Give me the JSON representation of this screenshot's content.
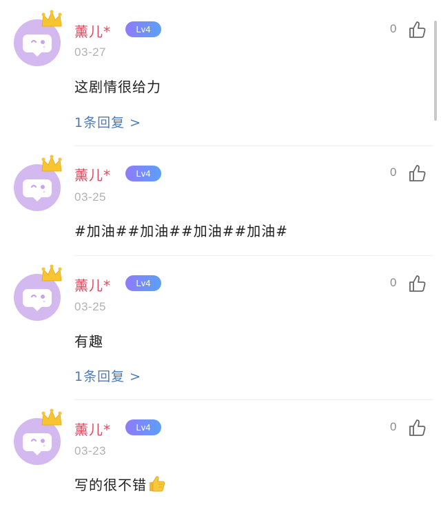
{
  "comments": [
    {
      "username": "薰儿*",
      "level": "Lv4",
      "date": "03-27",
      "text": "这剧情很给力",
      "replies": "1条回复 >",
      "likes": "0"
    },
    {
      "username": "薰儿*",
      "level": "Lv4",
      "date": "03-25",
      "text": "#加油##加油##加油##加油#",
      "likes": "0"
    },
    {
      "username": "薰儿*",
      "level": "Lv4",
      "date": "03-25",
      "text": "有趣",
      "replies": "1条回复 >",
      "likes": "0"
    },
    {
      "username": "薰儿*",
      "level": "Lv4",
      "date": "03-23",
      "text": "写的很不错",
      "emoji": "thumbs-up-emoji",
      "likes": "0"
    }
  ],
  "colors": {
    "username": "#e0475f",
    "reply_link": "#4c7ab8",
    "avatar": "#d3b9ef",
    "badge_start": "#8f7bfb",
    "badge_end": "#5aa0f8"
  },
  "icons": {
    "like": "thumbs-up-outline-icon",
    "avatar_badge": "crown-icon"
  }
}
